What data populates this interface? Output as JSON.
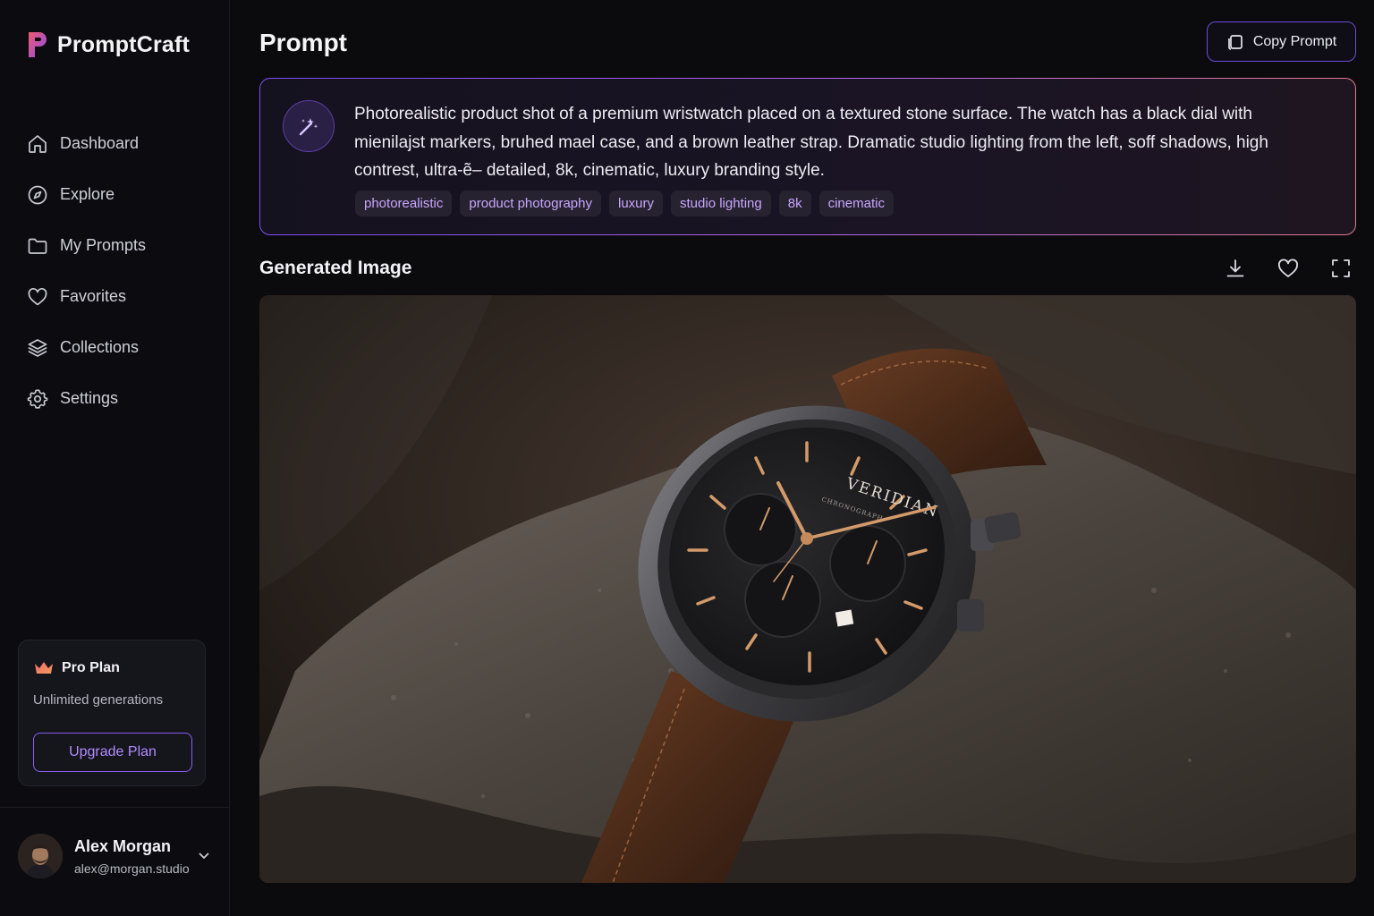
{
  "brand": {
    "name": "PromptCraft"
  },
  "nav": {
    "items": [
      {
        "label": "Dashboard",
        "icon": "home-icon"
      },
      {
        "label": "Explore",
        "icon": "compass-icon"
      },
      {
        "label": "My Prompts",
        "icon": "folder-icon"
      },
      {
        "label": "Favorites",
        "icon": "heart-icon"
      },
      {
        "label": "Collections",
        "icon": "layers-icon"
      },
      {
        "label": "Settings",
        "icon": "gear-icon"
      }
    ]
  },
  "plan": {
    "title": "Pro Plan",
    "description": "Unlimited generations",
    "upgrade_label": "Upgrade Plan",
    "icon": "crown-icon"
  },
  "user": {
    "name": "Alex Morgan",
    "email": "alex@morgan.studio"
  },
  "header": {
    "title": "Prompt",
    "copy_label": "Copy Prompt"
  },
  "prompt": {
    "text": "Photorealistic product shot of a premium wristwatch placed on a textured stone surface. The watch has a black dial with mienilajst markers, bruhed mael case, and a brown leather strap. Dramatic studio lighting from the left, soff shadows, high contrest, ultra-ẽ– detailed, 8k, cinematic, luxury branding style.",
    "tags": [
      "photorealistic",
      "product photography",
      "luxury",
      "studio lighting",
      "8k",
      "cinematic"
    ]
  },
  "generated": {
    "title": "Generated Image",
    "watch_brand": "VERIDIAN",
    "watch_subtitle": "CHRONOGRAPH"
  },
  "colors": {
    "accent": "#8d5cf6",
    "accent_text": "#b28bff",
    "tag_text": "#c8a6ff",
    "background": "#0b0b0e"
  }
}
